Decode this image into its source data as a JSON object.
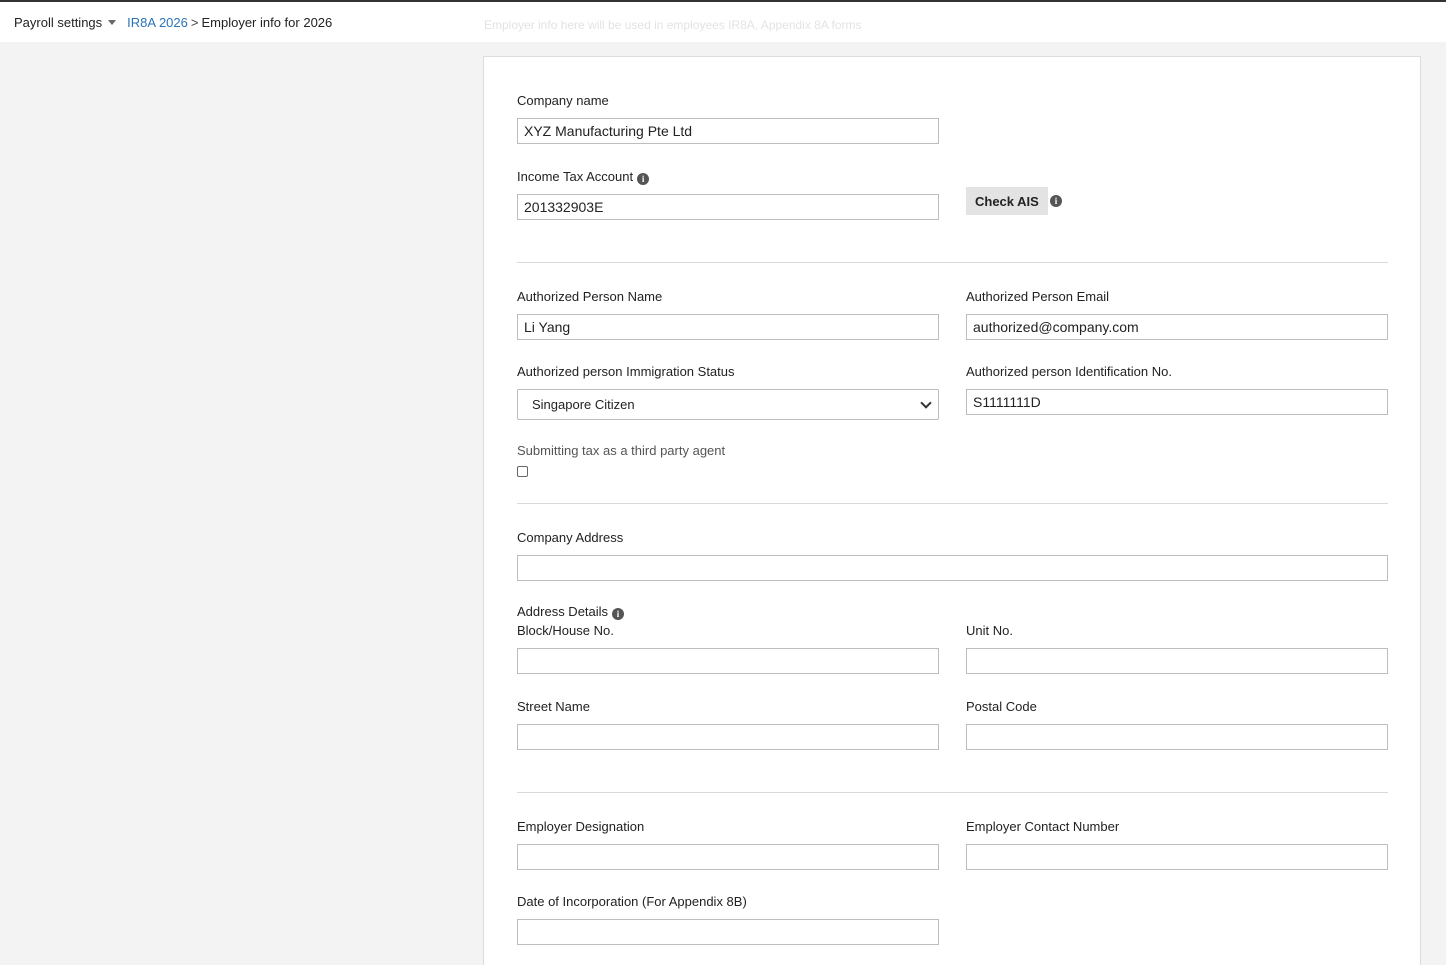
{
  "breadcrumb": {
    "menu_label": "Payroll settings",
    "link_label": "IR8A 2026",
    "separator": ">",
    "current": "Employer info for 2026"
  },
  "ghost_text": "Employer info here will be used in employees IR8A, Appendix 8A forms",
  "form": {
    "company_name": {
      "label": "Company name",
      "value": "XYZ Manufacturing Pte Ltd"
    },
    "income_tax_account": {
      "label": "Income Tax Account",
      "value": "201332903E"
    },
    "check_ais_label": "Check AIS",
    "auth_name": {
      "label": "Authorized Person Name",
      "value": "Li Yang"
    },
    "auth_email": {
      "label": "Authorized Person Email",
      "value": "authorized@company.com"
    },
    "auth_immigration": {
      "label": "Authorized person Immigration Status",
      "value": "Singapore Citizen"
    },
    "auth_id": {
      "label": "Authorized person Identification No.",
      "value": "S1111111D"
    },
    "third_party": {
      "label": "Submitting tax as a third party agent",
      "checked": false
    },
    "company_address": {
      "label": "Company Address",
      "value": ""
    },
    "address_details_label": "Address Details",
    "block_house": {
      "label": "Block/House No.",
      "value": ""
    },
    "unit_no": {
      "label": "Unit No.",
      "value": ""
    },
    "street_name": {
      "label": "Street Name",
      "value": ""
    },
    "postal_code": {
      "label": "Postal Code",
      "value": ""
    },
    "employer_designation": {
      "label": "Employer Designation",
      "value": ""
    },
    "employer_contact": {
      "label": "Employer Contact Number",
      "value": ""
    },
    "date_incorporation": {
      "label": "Date of Incorporation (For Appendix 8B)",
      "value": ""
    }
  },
  "icons": {
    "info": "info-icon",
    "dropdown": "caret-down-icon",
    "select": "chevron-down-icon"
  }
}
